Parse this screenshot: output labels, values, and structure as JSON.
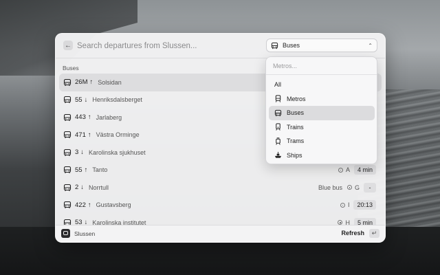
{
  "search": {
    "placeholder": "Search departures from Slussen..."
  },
  "filter": {
    "selected_label": "Buses"
  },
  "section_title": "Buses",
  "departures": [
    {
      "line": "26M",
      "arrow": "↑",
      "destination": "Solsidan",
      "extra": "",
      "stop": "",
      "time": ""
    },
    {
      "line": "55",
      "arrow": "↓",
      "destination": "Henriksdalsberget",
      "extra": "",
      "stop": "",
      "time": ""
    },
    {
      "line": "443",
      "arrow": "↑",
      "destination": "Jarlaberg",
      "extra": "",
      "stop": "",
      "time": ""
    },
    {
      "line": "471",
      "arrow": "↑",
      "destination": "Västra Orminge",
      "extra": "",
      "stop": "",
      "time": ""
    },
    {
      "line": "3",
      "arrow": "↓",
      "destination": "Karolinska sjukhuset",
      "extra": "",
      "stop": "",
      "time": ""
    },
    {
      "line": "55",
      "arrow": "↑",
      "destination": "Tanto",
      "extra": "",
      "stop": "A",
      "time": "4 min"
    },
    {
      "line": "2",
      "arrow": "↓",
      "destination": "Norrtull",
      "extra": "Blue bus",
      "stop": "G",
      "time": "-"
    },
    {
      "line": "422",
      "arrow": "↑",
      "destination": "Gustavsberg",
      "extra": "",
      "stop": "I",
      "time": "20:13"
    },
    {
      "line": "53",
      "arrow": "↓",
      "destination": "Karolinska institutet",
      "extra": "",
      "stop": "H",
      "time": "5 min"
    }
  ],
  "dropdown": {
    "placeholder": "Metros...",
    "items": [
      {
        "label": "All",
        "icon": ""
      },
      {
        "label": "Metros",
        "icon": "metro-icon"
      },
      {
        "label": "Buses",
        "icon": "bus-icon"
      },
      {
        "label": "Trains",
        "icon": "train-icon"
      },
      {
        "label": "Trams",
        "icon": "tram-icon"
      },
      {
        "label": "Ships",
        "icon": "ship-icon"
      }
    ]
  },
  "footer": {
    "location": "Slussen",
    "refresh_label": "Refresh",
    "enter_key": "↵"
  },
  "back_glyph": "←",
  "chevron_glyph": "⌃"
}
